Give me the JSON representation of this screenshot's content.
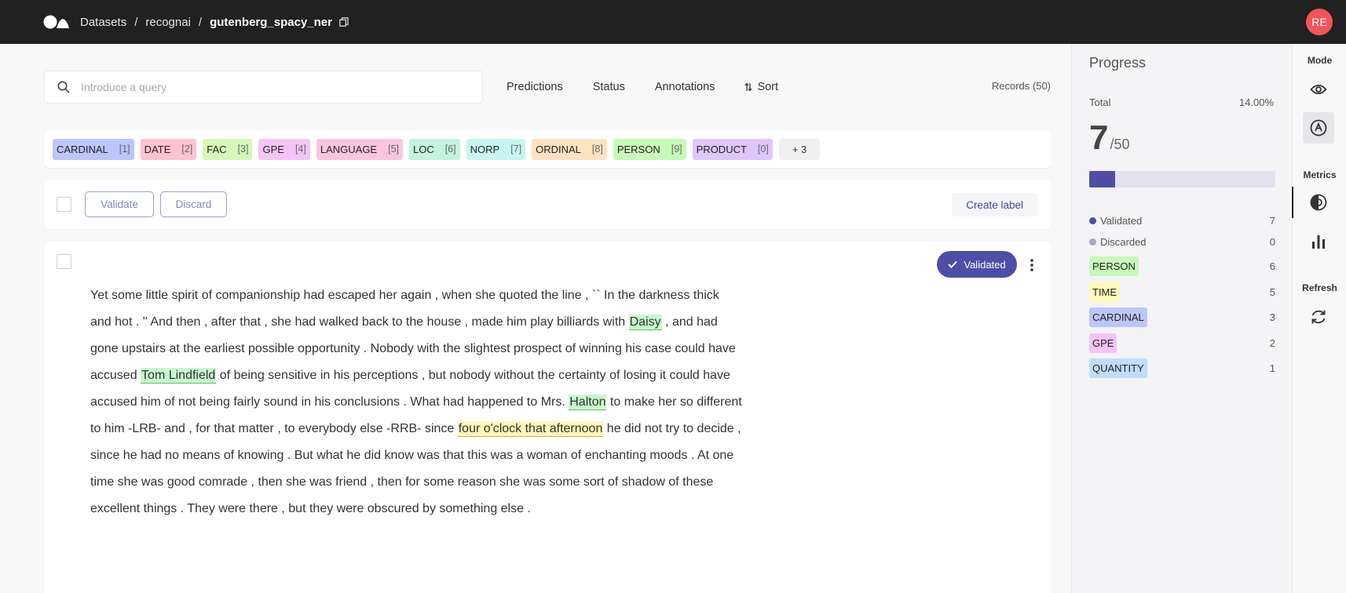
{
  "topbar": {
    "breadcrumbs": [
      "Datasets",
      "recognai",
      "gutenberg_spacy_ner"
    ],
    "avatar": "RE"
  },
  "search": {
    "placeholder": "Introduce a query"
  },
  "filters": {
    "predictions": "Predictions",
    "status": "Status",
    "annotations": "Annotations",
    "sort": "Sort"
  },
  "records_count": "Records (50)",
  "labels": [
    {
      "name": "CARDINAL",
      "key": "[1]",
      "color": "#bcc6fb"
    },
    {
      "name": "DATE",
      "key": "[2]",
      "color": "#ffc2d1"
    },
    {
      "name": "FAC",
      "key": "[3]",
      "color": "#d5f7b8"
    },
    {
      "name": "GPE",
      "key": "[4]",
      "color": "#f4c4f6"
    },
    {
      "name": "LANGUAGE",
      "key": "[5]",
      "color": "#fcc5df"
    },
    {
      "name": "LOC",
      "key": "[6]",
      "color": "#c3f3de"
    },
    {
      "name": "NORP",
      "key": "[7]",
      "color": "#c6f5f4"
    },
    {
      "name": "ORDINAL",
      "key": "[8]",
      "color": "#ffe2c0"
    },
    {
      "name": "PERSON",
      "key": "[9]",
      "color": "#c7f9b8"
    },
    {
      "name": "PRODUCT",
      "key": "[0]",
      "color": "#e0c6fb"
    }
  ],
  "labels_more": "+ 3",
  "bulk": {
    "validate": "Validate",
    "discard": "Discard",
    "create_label": "Create label"
  },
  "record": {
    "status": "Validated",
    "segments": [
      {
        "text": "Yet some little spirit of companionship had escaped her again , when she quoted the line , `` In the darkness thick and hot . '' And then , after that , she had walked back to the house , made him play billiards with "
      },
      {
        "text": "Daisy",
        "entity": "person"
      },
      {
        "text": " , and had gone upstairs at the earliest possible opportunity . Nobody with the slightest prospect of winning his case could have accused "
      },
      {
        "text": "Tom Lindfield",
        "entity": "person"
      },
      {
        "text": " of being sensitive in his perceptions , but nobody without the certainty of losing it could have accused him of not being fairly sound in his conclusions . What had happened to Mrs. "
      },
      {
        "text": "Halton",
        "entity": "person"
      },
      {
        "text": " to make her so different to him -LRB- and , for that matter , to everybody else -RRB- since "
      },
      {
        "text": "four o'clock that afternoon",
        "entity": "time"
      },
      {
        "text": " he did not try to decide , since he had no means of knowing . But what he did know was that this was a woman of enchanting moods . At one time she was good comrade , then she was friend , then for some reason she was some sort of shadow of these excellent things . They were there , but they were obscured by something else ."
      }
    ]
  },
  "progress": {
    "title": "Progress",
    "total_label": "Total",
    "total_percent": "14.00%",
    "count": "7",
    "of_total": "/50",
    "fraction": 0.14,
    "validated_label": "Validated",
    "validated_count": "7",
    "validated_color": "#4c4ea8",
    "discarded_label": "Discarded",
    "discarded_count": "0",
    "discarded_color": "#a3a6d6",
    "labels": [
      {
        "name": "PERSON",
        "count": "6",
        "color": "#c7f9b8"
      },
      {
        "name": "TIME",
        "count": "5",
        "color": "#fff9b8"
      },
      {
        "name": "CARDINAL",
        "count": "3",
        "color": "#bcc6fb"
      },
      {
        "name": "GPE",
        "count": "2",
        "color": "#f4c4f6"
      },
      {
        "name": "QUANTITY",
        "count": "1",
        "color": "#c2dcfb"
      }
    ]
  },
  "sidebar": {
    "mode": "Mode",
    "metrics": "Metrics",
    "refresh": "Refresh"
  }
}
